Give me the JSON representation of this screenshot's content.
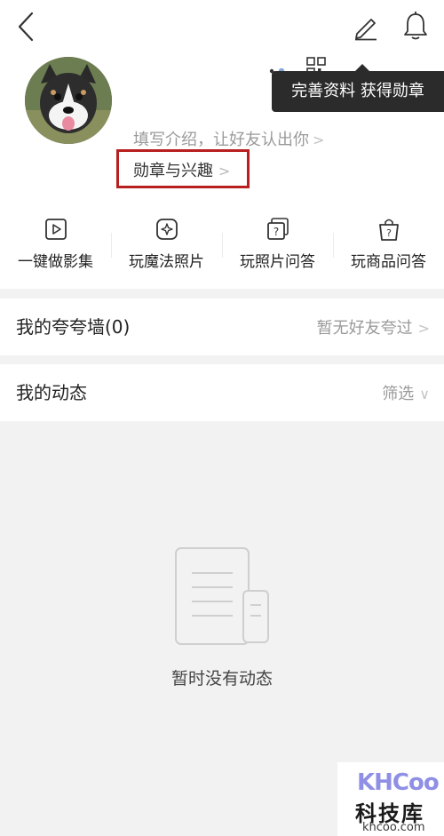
{
  "tooltip": {
    "text": "完善资料 获得勋章"
  },
  "profile": {
    "bio_placeholder": "填写介绍，让好友认出你",
    "bio_chevron": ">",
    "badges_label": "勋章与兴趣",
    "badges_chevron": ">"
  },
  "shortcuts": [
    {
      "label": "一键做影集",
      "icon": "play-video-icon"
    },
    {
      "label": "玩魔法照片",
      "icon": "magic-photo-icon"
    },
    {
      "label": "玩照片问答",
      "icon": "photo-question-icon"
    },
    {
      "label": "玩商品问答",
      "icon": "product-question-icon"
    }
  ],
  "praise_wall": {
    "title": "我的夸夸墙(0)",
    "status": "暂无好友夸过",
    "chevron": ">"
  },
  "activity": {
    "title": "我的动态",
    "filter_label": "筛选",
    "filter_chevron": "∨",
    "empty_text": "暂时没有动态"
  },
  "watermark": {
    "logo": "KHCoo",
    "cn": "科技库",
    "url": "khcoo.com"
  },
  "colors": {
    "highlight_border": "#b8201f",
    "tooltip_bg": "#2b2b2b",
    "muted_text": "#9a9a9a",
    "page_bg": "#f2f2f2"
  }
}
